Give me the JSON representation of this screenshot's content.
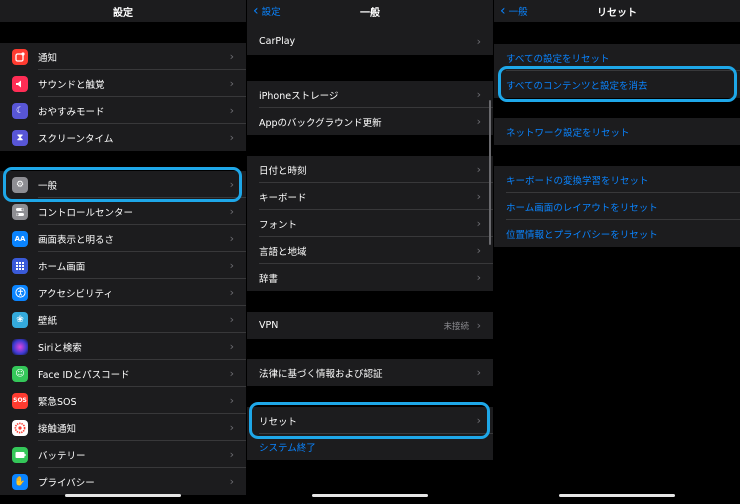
{
  "screen1": {
    "title": "設定",
    "items": [
      {
        "label": "通知",
        "icon": "notifications-icon",
        "color": "#ff3b30"
      },
      {
        "label": "サウンドと触覚",
        "icon": "sounds-icon",
        "color": "#ff2d55"
      },
      {
        "label": "おやすみモード",
        "icon": "moon-icon",
        "color": "#5856d6"
      },
      {
        "label": "スクリーンタイム",
        "icon": "hourglass-icon",
        "color": "#5856d6"
      },
      {
        "label": "一般",
        "icon": "gear-icon",
        "color": "#8e8e93"
      },
      {
        "label": "コントロールセンター",
        "icon": "toggles-icon",
        "color": "#8e8e93"
      },
      {
        "label": "画面表示と明るさ",
        "icon": "display-icon",
        "color": "#0a84ff"
      },
      {
        "label": "ホーム画面",
        "icon": "home-grid-icon",
        "color": "#3a5ad9"
      },
      {
        "label": "アクセシビリティ",
        "icon": "accessibility-icon",
        "color": "#0a84ff"
      },
      {
        "label": "壁紙",
        "icon": "wallpaper-icon",
        "color": "#34aadc"
      },
      {
        "label": "Siriと検索",
        "icon": "siri-icon",
        "color": "#222"
      },
      {
        "label": "Face IDとパスコード",
        "icon": "faceid-icon",
        "color": "#34c759"
      },
      {
        "label": "緊急SOS",
        "icon": "sos-icon",
        "color": "#ff3b30"
      },
      {
        "label": "接触通知",
        "icon": "exposure-icon",
        "color": "#ffffff"
      },
      {
        "label": "バッテリー",
        "icon": "battery-icon",
        "color": "#34c759"
      },
      {
        "label": "プライバシー",
        "icon": "privacy-hand-icon",
        "color": "#0a84ff"
      }
    ],
    "sos_text": "SOS",
    "aa_text": "AA"
  },
  "screen2": {
    "back": "設定",
    "title": "一般",
    "carplay": "CarPlay",
    "storage": "iPhoneストレージ",
    "bg_refresh": "Appのバックグラウンド更新",
    "datetime": "日付と時刻",
    "keyboard": "キーボード",
    "font": "フォント",
    "language": "言語と地域",
    "dictionary": "辞書",
    "vpn": "VPN",
    "vpn_status": "未接続",
    "legal": "法律に基づく情報および認証",
    "reset": "リセット",
    "shutdown": "システム終了"
  },
  "screen3": {
    "back": "一般",
    "title": "リセット",
    "reset_all": "すべての設定をリセット",
    "erase_all": "すべてのコンテンツと設定を消去",
    "reset_network": "ネットワーク設定をリセット",
    "reset_keyboard": "キーボードの変換学習をリセット",
    "reset_home": "ホーム画面のレイアウトをリセット",
    "reset_location": "位置情報とプライバシーをリセット"
  }
}
